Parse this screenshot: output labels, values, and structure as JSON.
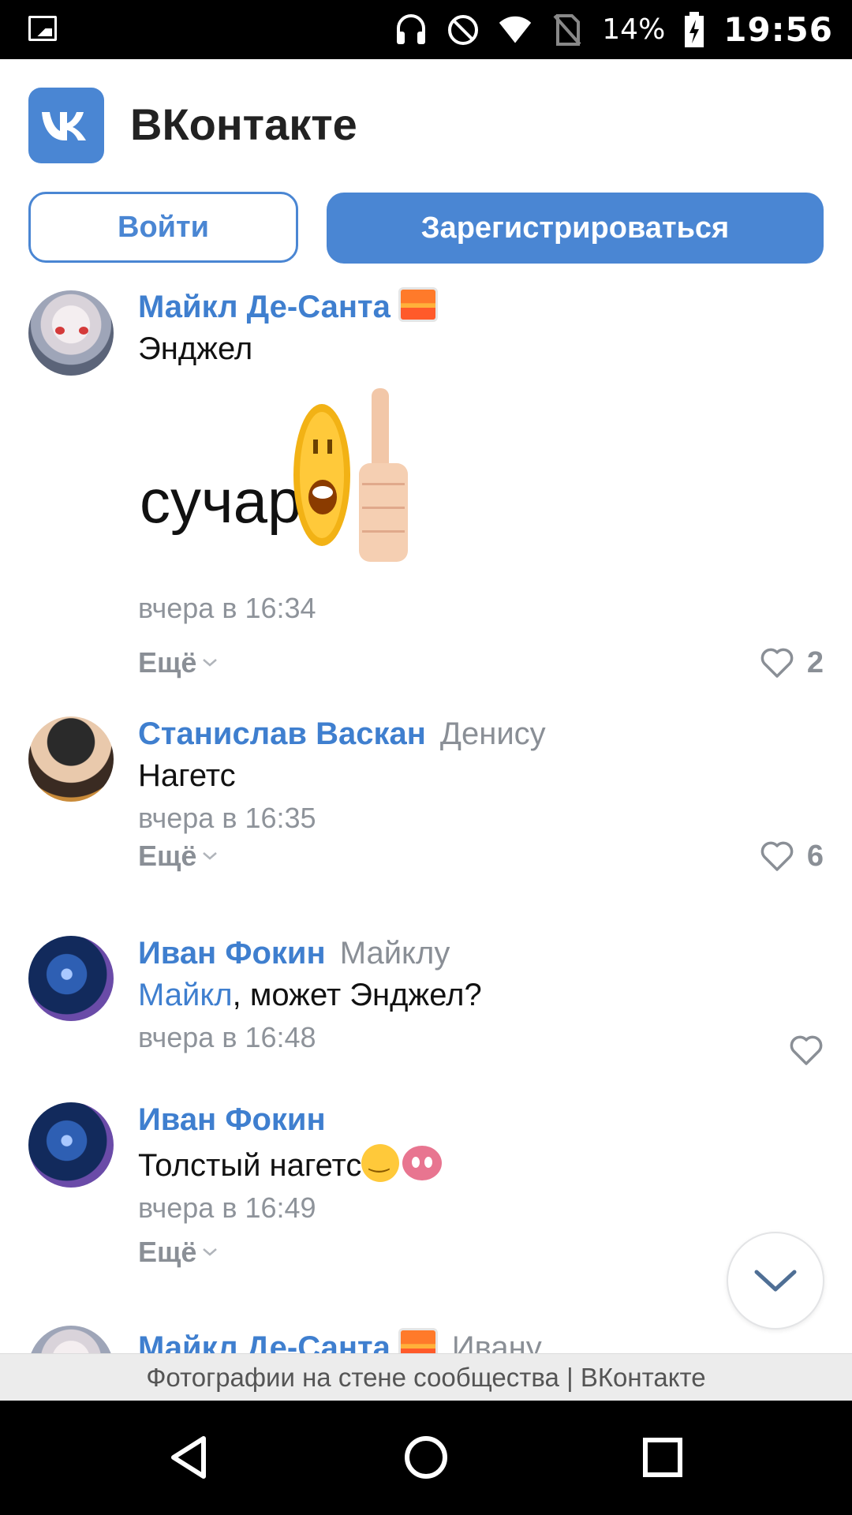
{
  "status_bar": {
    "battery_percent": "14%",
    "time": "19:56",
    "icons": [
      "gallery-icon",
      "headset-icon",
      "do-not-disturb-icon",
      "wifi-icon",
      "no-sim-icon",
      "battery-charging-icon"
    ]
  },
  "header": {
    "title": "ВКонтакте",
    "logo_text": "VK",
    "brand_color": "#4a86d3"
  },
  "auth": {
    "login_label": "Войти",
    "register_label": "Зарегистрироваться"
  },
  "comments": [
    {
      "author": "Майкл Де-Санта",
      "author_emoji": "sunset-emoji",
      "text": "Энджел",
      "sticker_text": "сучара",
      "time": "вчера в 16:34",
      "more_label": "Ещё",
      "likes": "2"
    },
    {
      "author": "Станислав Васкан",
      "reply_to": "Денису",
      "text": "Нагетс",
      "time": "вчера в 16:35",
      "more_label": "Ещё",
      "likes": "6"
    },
    {
      "author": "Иван Фокин",
      "reply_to": "Майклу",
      "mention": "Майкл",
      "text": ", может Энджел?",
      "time": "вчера в 16:48"
    },
    {
      "author": "Иван Фокин",
      "text": "Толстый нагетс",
      "time": "вчера в 16:49",
      "more_label": "Ещё"
    },
    {
      "author": "Майкл Де-Санта",
      "author_emoji": "sunset-emoji",
      "reply_to": "Ивану"
    }
  ],
  "caption": "Фотографии на стене сообщества | ВКонтакте",
  "navigation": [
    "back-icon",
    "home-icon",
    "recents-icon"
  ]
}
